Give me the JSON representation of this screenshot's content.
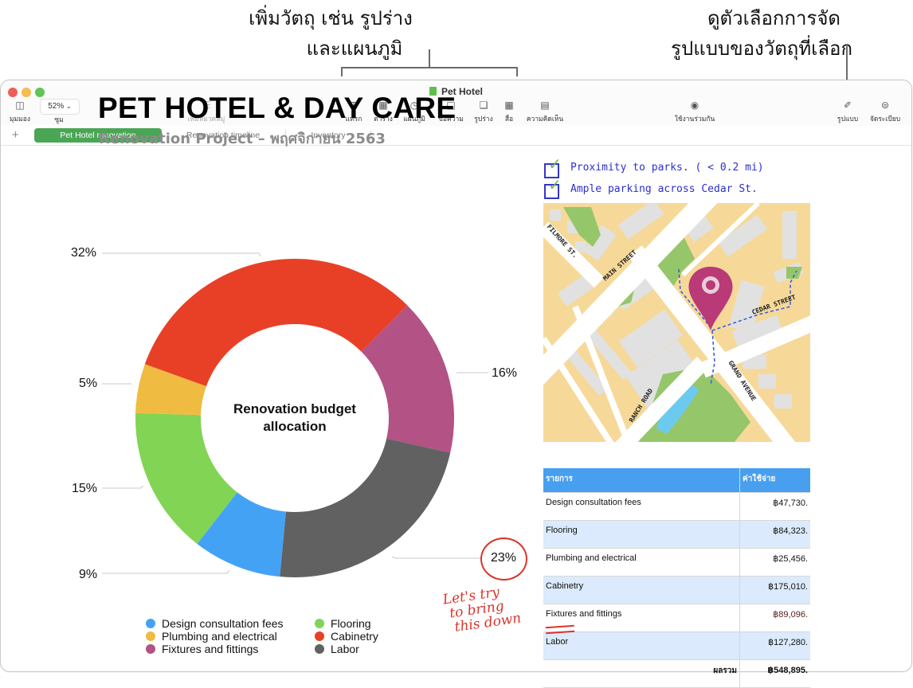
{
  "callouts": {
    "left": [
      "เพิ่มวัตถุ เช่น รูปร่าง",
      "และแผนภูมิ"
    ],
    "right": [
      "ดูตัวเลือกการจัด",
      "รูปแบบของวัตถุที่เลือก"
    ]
  },
  "window": {
    "title": "Pet Hotel",
    "traffic_colors": {
      "close": "#ee5f57",
      "minimize": "#f5bd4f",
      "zoom": "#61c454"
    }
  },
  "toolbar": {
    "view": {
      "label": "มุมมอง",
      "icon": "sidebar-icon"
    },
    "zoom": {
      "label": "ซูม",
      "value": "52%"
    },
    "add_category": {
      "label": "เพิ่มหมวดหมู่",
      "icon": "list-icon",
      "enabled": false
    },
    "insert": {
      "label": "แทรก",
      "icon": "insert-icon"
    },
    "table": {
      "label": "ตาราง",
      "icon": "table-icon"
    },
    "chart": {
      "label": "แผนภูมิ",
      "icon": "chart-icon"
    },
    "text": {
      "label": "ข้อความ",
      "icon": "text-icon"
    },
    "shape": {
      "label": "รูปร่าง",
      "icon": "shape-icon"
    },
    "media": {
      "label": "สื่อ",
      "icon": "media-icon"
    },
    "comment": {
      "label": "ความคิดเห็น",
      "icon": "comment-icon"
    },
    "collaborate": {
      "label": "ใช้งานร่วมกัน",
      "icon": "collaborate-icon"
    },
    "format": {
      "label": "รูปแบบ",
      "icon": "paintbrush-icon"
    },
    "organize": {
      "label": "จัดระเบียบ",
      "icon": "organize-icon"
    }
  },
  "tabs": [
    {
      "label": "Pet Hotel renovation",
      "active": true
    },
    {
      "label": "Renovation timeline",
      "active": false
    },
    {
      "label": "Inventory",
      "active": false
    }
  ],
  "sheet": {
    "title": "PET HOTEL & DAY CARE",
    "subtitle": "Renovation Project – พฤศจิกายน 2563",
    "notes": [
      "Proximity to parks. ( < 0.2 mi)",
      "Ample parking across  Cedar St."
    ],
    "handwritten_note": [
      "Let's try",
      "to bring",
      "this down"
    ],
    "map": {
      "streets": [
        "FILMORE ST.",
        "MAIN STREET",
        "CEDAR STREET",
        "GRAND AVENUE",
        "RANCH ROAD"
      ],
      "pin_color": "#b93a76"
    },
    "table": {
      "headers": [
        "รายการ",
        "ค่าใช้จ่าย"
      ],
      "rows": [
        {
          "item": "Design consultation fees",
          "cost": "฿47,730."
        },
        {
          "item": "Flooring",
          "cost": "฿84,323."
        },
        {
          "item": "Plumbing and electrical",
          "cost": "฿25,456."
        },
        {
          "item": "Cabinetry",
          "cost": "฿175,010."
        },
        {
          "item": "Fixtures and fittings",
          "cost": "฿89,096."
        },
        {
          "item": "Labor",
          "cost": "฿127,280."
        }
      ],
      "total_label": "ผลรวม",
      "total_value": "฿548,895."
    }
  },
  "chart_data": {
    "type": "pie",
    "variant": "donut",
    "title": "Renovation budget allocation",
    "categories": [
      "Fixtures and fittings",
      "Labor",
      "Design consultation fees",
      "Flooring",
      "Plumbing and electrical",
      "Cabinetry"
    ],
    "values": [
      16,
      23,
      9,
      15,
      5,
      32
    ],
    "labels": [
      "16%",
      "23%",
      "9%",
      "15%",
      "5%",
      "32%"
    ],
    "colors": [
      "#b35284",
      "#616161",
      "#44a2f5",
      "#82d455",
      "#f0bb41",
      "#e84027"
    ],
    "start_angle_deg": 45,
    "direction": "clockwise",
    "legend": {
      "placement": "bottom",
      "items": [
        {
          "label": "Design consultation fees",
          "color": "#44a2f5"
        },
        {
          "label": "Plumbing and electrical",
          "color": "#f0bb41"
        },
        {
          "label": "Fixtures and fittings",
          "color": "#b35284"
        },
        {
          "label": "Flooring",
          "color": "#82d455"
        },
        {
          "label": "Cabinetry",
          "color": "#e84027"
        },
        {
          "label": "Labor",
          "color": "#616161"
        }
      ]
    }
  }
}
